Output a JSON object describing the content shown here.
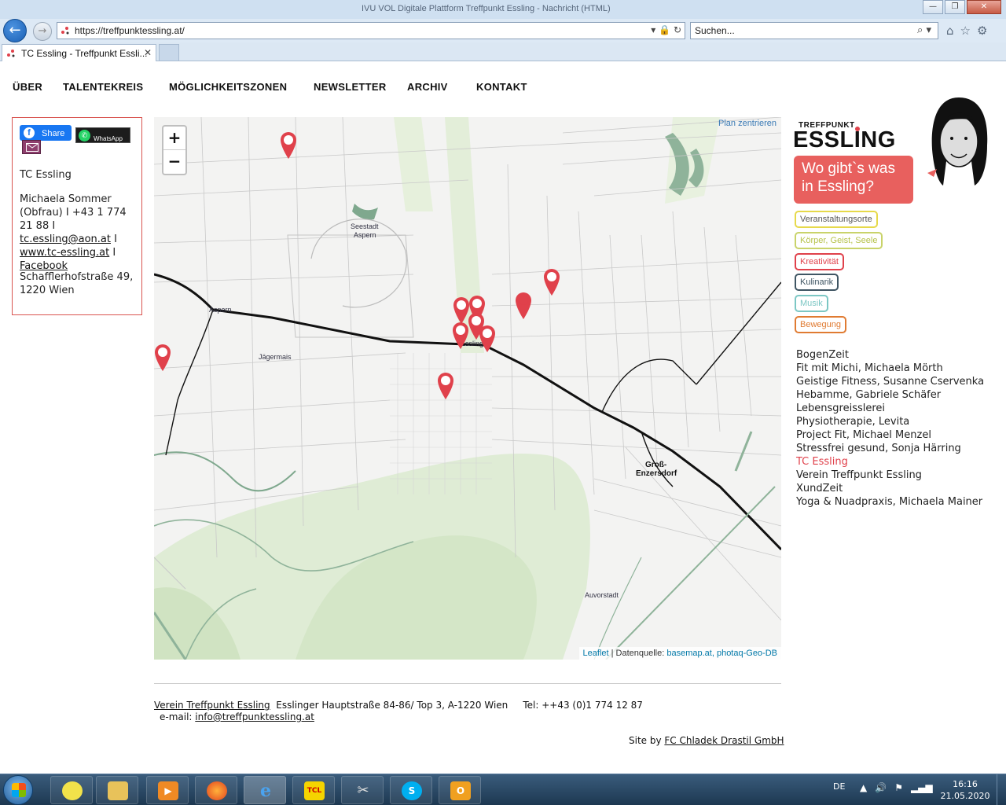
{
  "browser": {
    "window_title": "IVU VOL Digitale Plattform Treffpunkt Essling - Nachricht (HTML)",
    "window_controls": {
      "minimize": "—",
      "restore": "❐",
      "close": "✕"
    },
    "url": "https://treffpunktessling.at/",
    "search_placeholder": "Suchen...",
    "tab_title": "TC Essling - Treffpunkt Essli...",
    "tab_close": "✕",
    "icons": [
      "back-icon",
      "forward-icon",
      "home-icon",
      "star-icon",
      "gear-icon",
      "search-icon",
      "lock-icon",
      "refresh-icon"
    ]
  },
  "site_nav": {
    "items": [
      "ÜBER",
      "TALENTEKREIS",
      "MÖGLICHKEITSZONEN",
      "NEWSLETTER",
      "ARCHIV",
      "KONTAKT"
    ]
  },
  "info_box": {
    "share_label": "Share",
    "whatsapp_label": "WhatsApp",
    "title": "TC Essling",
    "contact_text": "Michaela Sommer (Obfrau) I +43 1 774 21 88 I ",
    "email": "tc.essling@aon.at",
    "sep": " I ",
    "website": "www.tc-essling.at",
    "sep2": " I ",
    "facebook": "Facebook",
    "address_line1": "Schafflerhofstraße 49,",
    "address_line2": "1220 Wien",
    "border_color": "#d9534f"
  },
  "map": {
    "plan_zentrieren": "Plan zentrieren",
    "zoom_in": "+",
    "zoom_out": "−",
    "attribution_leaflet": "Leaflet",
    "attribution_sep": " | Datenquelle: ",
    "attribution_source": "basemap.at, photaq-Geo-DB",
    "place_labels": {
      "seestadt": "Seestadt",
      "aspern_seestadt": "Aspern",
      "aspern": "Aspern",
      "jaegermais": "Jägermais",
      "essling": "Essling",
      "gross": "Groß-",
      "enzersdorf": "Enzersdorf",
      "auvorstadt": "Auvorstadt"
    },
    "pin_color": "#e0414b"
  },
  "brand": {
    "small": "TREFFPUNKT",
    "big": "ESSLING",
    "bubble_line1": "Wo gibt`s was",
    "bubble_line2": "in Essling?"
  },
  "categories": [
    {
      "label": "Veranstaltungsorte",
      "color": "#e6d94a"
    },
    {
      "label": "Körper, Geist, Seele",
      "color": "#c9d36a"
    },
    {
      "label": "Kreativität",
      "color": "#e0414b"
    },
    {
      "label": "Kulinarik",
      "color": "#3f5563"
    },
    {
      "label": "Musik",
      "color": "#7cc7c4"
    },
    {
      "label": "Bewegung",
      "color": "#e07b32"
    }
  ],
  "entries": [
    "BogenZeit",
    "Fit mit Michi, Michaela Mörth",
    "Geistige Fitness, Susanne Cservenka",
    "Hebamme, Gabriele Schäfer",
    "Lebensgreisslerei",
    "Physiotherapie, Levita",
    "Project Fit, Michael Menzel",
    "Stressfrei gesund, Sonja Härring",
    "TC Essling",
    "Verein Treffpunkt Essling",
    "XundZeit",
    "Yoga & Nuadpraxis, Michaela Mainer"
  ],
  "footer": {
    "org_link": "Verein Treffpunkt Essling",
    "address": "  Esslinger Hauptstraße 84-86/ Top 3, A-1220 Wien     Tel: ++43 (0)1 774 12 87",
    "email_label": "e-mail: ",
    "email": "info@treffpunktessling.at",
    "site_by": "Site by ",
    "agency": "FC Chladek Drastil GmbH"
  },
  "taskbar": {
    "language": "DE",
    "time": "16:16",
    "date": "21.05.2020",
    "apps": [
      "windows-start",
      "sticky-notes",
      "file-explorer",
      "media-player",
      "firefox",
      "internet-explorer",
      "tcl-app",
      "snipping-tool",
      "skype",
      "outlook"
    ]
  }
}
